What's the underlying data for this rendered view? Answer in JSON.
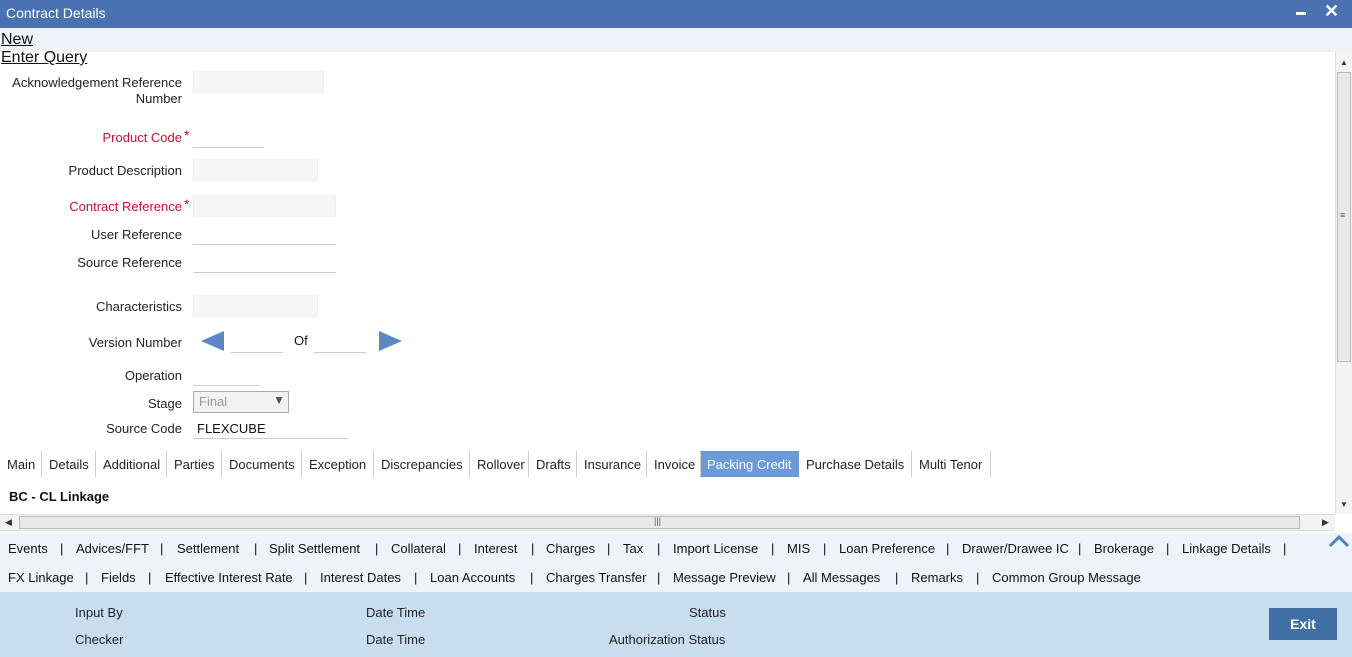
{
  "window": {
    "title": "Contract Details"
  },
  "menu": {
    "new": "New",
    "enter_query": "Enter Query"
  },
  "form": {
    "ack_ref_label_1": "Acknowledgement Reference",
    "ack_ref_label_2": "Number",
    "product_code_label": "Product Code",
    "required_mark": "*",
    "product_description_label": "Product Description",
    "contract_reference_label": "Contract Reference",
    "user_reference_label": "User Reference",
    "source_reference_label": "Source Reference",
    "characteristics_label": "Characteristics",
    "version_number_label": "Version Number",
    "of_label": "Of",
    "operation_label": "Operation",
    "stage_label": "Stage",
    "stage_value": "Final",
    "source_code_label": "Source Code",
    "source_code_value": "FLEXCUBE"
  },
  "tabs": [
    "Main",
    "Details",
    "Additional",
    "Parties",
    "Documents",
    "Exception",
    "Discrepancies",
    "Rollover",
    "Drafts",
    "Insurance",
    "Invoice",
    "Packing Credit",
    "Purchase Details",
    "Multi Tenor"
  ],
  "active_tab": "Packing Credit",
  "section": {
    "title": "BC - CL Linkage"
  },
  "links_row1": [
    "Events",
    "Advices/FFT",
    "Settlement",
    "Split Settlement",
    "Collateral",
    "Interest",
    "Charges",
    "Tax",
    "Import License",
    "MIS",
    "Loan Preference",
    "Drawer/Drawee IC",
    "Brokerage",
    "Linkage Details"
  ],
  "links_row2": [
    "FX Linkage",
    "Fields",
    "Effective Interest Rate",
    "Interest Dates",
    "Loan Accounts",
    "Charges Transfer",
    "Message Preview",
    "All Messages",
    "Remarks",
    "Common Group Message"
  ],
  "separator": "|",
  "footer": {
    "input_by": "Input By",
    "date_time": "Date Time",
    "status": "Status",
    "checker": "Checker",
    "auth_status": "Authorization Status",
    "exit": "Exit"
  },
  "colors": {
    "title_bar": "#4a72b0",
    "active_tab": "#6a9bd8",
    "required": "#c8102e",
    "footer": "#c8ddef",
    "exit_button": "#3f6fa5"
  }
}
